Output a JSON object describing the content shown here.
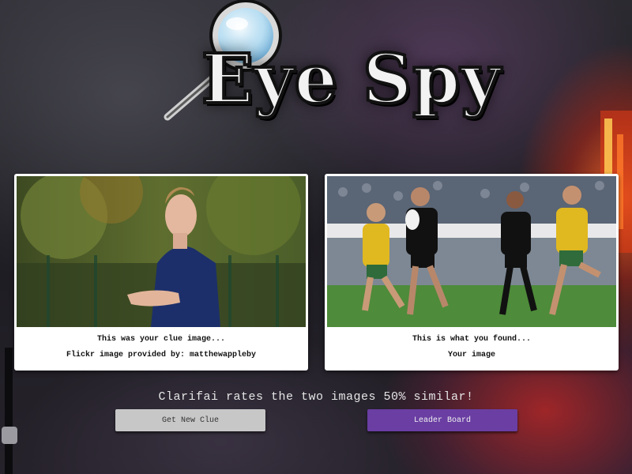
{
  "logo": {
    "text": "Eye Spy"
  },
  "clue_card": {
    "caption": "This was your clue image...",
    "credit": "Flickr image provided by: matthewappleby"
  },
  "found_card": {
    "caption": "This is what you found...",
    "label": "Your image"
  },
  "rating": {
    "text": "Clarifai rates the two images 50% similar!"
  },
  "buttons": {
    "new_clue": "Get New Clue",
    "leader_board": "Leader Board"
  },
  "colors": {
    "leader_button": "#6a3ea3",
    "clue_button": "#c7c7c7",
    "card_background": "#ffffff"
  }
}
